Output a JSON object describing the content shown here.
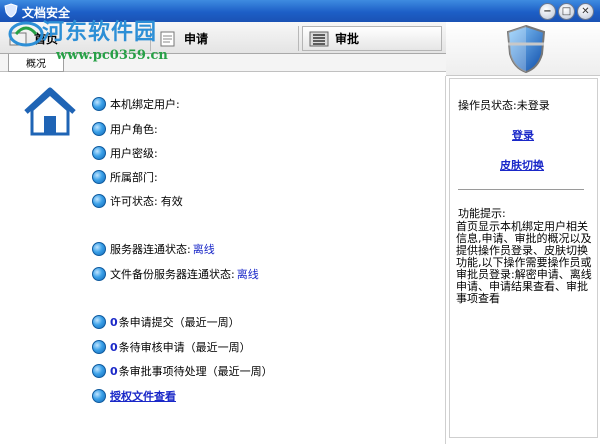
{
  "window": {
    "title": "文档安全"
  },
  "toolbar": {
    "tabs": [
      {
        "label": "首页"
      },
      {
        "label": "申请"
      },
      {
        "label": "审批"
      }
    ]
  },
  "subbar": {
    "tab_label": "概况"
  },
  "watermark": {
    "line1": "河东软件园",
    "line2": "www.pc0359.cn"
  },
  "main": {
    "info": [
      {
        "label": "本机绑定用户:",
        "value": ""
      },
      {
        "label": "用户角色:",
        "value": ""
      },
      {
        "label": "用户密级:",
        "value": ""
      },
      {
        "label": "所属部门:",
        "value": ""
      },
      {
        "label": "许可状态:",
        "value": "有效"
      }
    ],
    "servers": [
      {
        "label": "服务器连通状态:",
        "value": "离线"
      },
      {
        "label": "文件备份服务器连通状态:",
        "value": "离线"
      }
    ],
    "requests": [
      {
        "count": "0",
        "text": "条申请提交（最近一周）"
      },
      {
        "count": "0",
        "text": "条待审核申请（最近一周）"
      },
      {
        "count": "0",
        "text": "条审批事项待处理（最近一周）"
      }
    ],
    "auth_link": "授权文件查看"
  },
  "right": {
    "operator_status": "操作员状态:未登录",
    "login": "登录",
    "skin": "皮肤切换",
    "func_title": "功能提示:",
    "func_desc": "首页显示本机绑定用户相关信息,申请、审批的概况以及提供操作员登录、皮肤切换功能,以下操作需要操作员或审批员登录:解密申请、离线申请、申请结果查看、审批事项查看"
  },
  "colors": {
    "titlebar": "#1d5fc7",
    "link": "#1a28c8",
    "bullet": "#3aa0e8"
  }
}
